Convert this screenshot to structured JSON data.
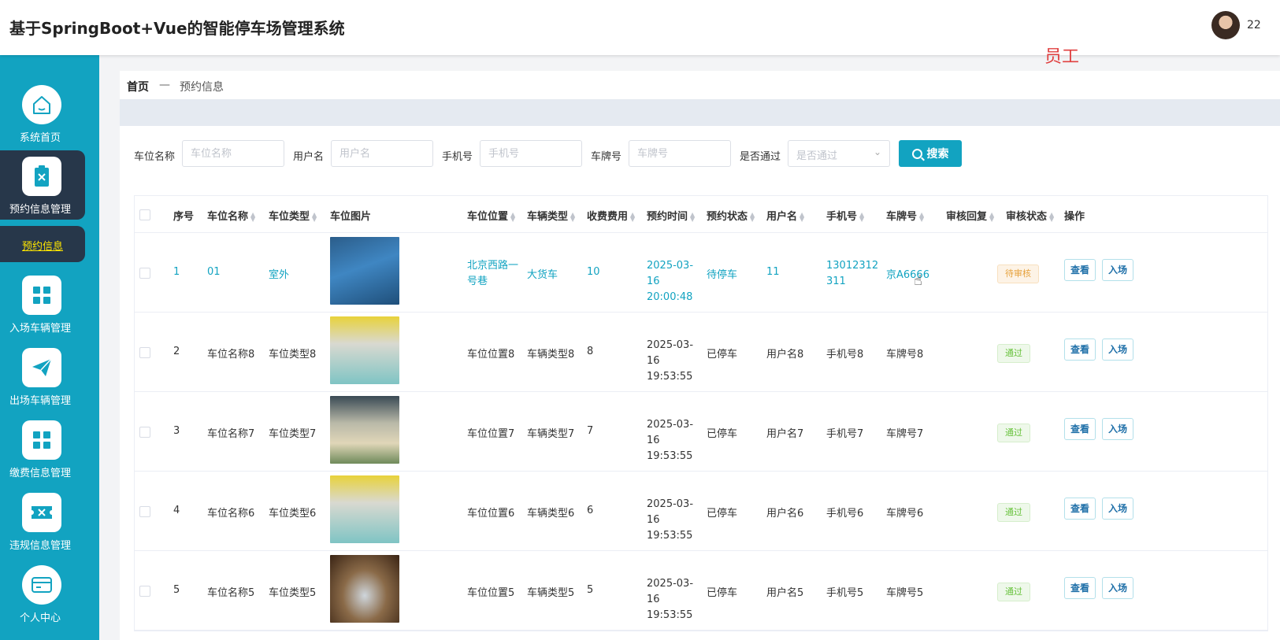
{
  "app": {
    "title": "基于SpringBoot+Vue的智能停车场管理系统",
    "username": "22",
    "role_label": "员工"
  },
  "sidebar": {
    "items": [
      {
        "label": "系统首页",
        "icon": "home-icon"
      },
      {
        "label": "预约信息管理",
        "icon": "clipboard-x-icon"
      },
      {
        "label": "入场车辆管理",
        "icon": "grid-icon"
      },
      {
        "label": "出场车辆管理",
        "icon": "paper-plane-icon"
      },
      {
        "label": "缴费信息管理",
        "icon": "grid-icon"
      },
      {
        "label": "违规信息管理",
        "icon": "ticket-icon"
      },
      {
        "label": "个人中心",
        "icon": "wallet-icon"
      }
    ],
    "sub_active": "预约信息",
    "active_color": "#27374a",
    "sub_active_color": "#ffe600"
  },
  "breadcrumb": {
    "home": "首页",
    "sep": "—",
    "current": "预约信息"
  },
  "filters": {
    "parking_name": {
      "label": "车位名称",
      "placeholder": "车位名称"
    },
    "user_name": {
      "label": "用户名",
      "placeholder": "用户名"
    },
    "phone": {
      "label": "手机号",
      "placeholder": "手机号"
    },
    "plate": {
      "label": "车牌号",
      "placeholder": "车牌号"
    },
    "passed": {
      "label": "是否通过",
      "placeholder": "是否通过"
    },
    "search_label": "搜索"
  },
  "table": {
    "columns": [
      "序号",
      "车位名称",
      "车位类型",
      "车位图片",
      "车位位置",
      "车辆类型",
      "收费费用",
      "预约时间",
      "预约状态",
      "用户名",
      "手机号",
      "车牌号",
      "审核回复",
      "审核状态",
      "操作"
    ],
    "view_label": "查看",
    "enter_label": "入场",
    "rows": [
      {
        "no": "1",
        "name": "01",
        "type": "室外",
        "location": "北京西路一号巷",
        "vehicle": "大货车",
        "fee": "10",
        "time": "2025-03-16 20:00:48",
        "status": "待停车",
        "user": "11",
        "phone": "13012312311",
        "plate": "京A6666",
        "reply": "",
        "audit": "待审核"
      },
      {
        "no": "2",
        "name": "车位名称8",
        "type": "车位类型8",
        "location": "车位位置8",
        "vehicle": "车辆类型8",
        "fee": "8",
        "time": "2025-03-16 19:53:55",
        "status": "已停车",
        "user": "用户名8",
        "phone": "手机号8",
        "plate": "车牌号8",
        "reply": "",
        "audit": "通过"
      },
      {
        "no": "3",
        "name": "车位名称7",
        "type": "车位类型7",
        "location": "车位位置7",
        "vehicle": "车辆类型7",
        "fee": "7",
        "time": "2025-03-16 19:53:55",
        "status": "已停车",
        "user": "用户名7",
        "phone": "手机号7",
        "plate": "车牌号7",
        "reply": "",
        "audit": "通过"
      },
      {
        "no": "4",
        "name": "车位名称6",
        "type": "车位类型6",
        "location": "车位位置6",
        "vehicle": "车辆类型6",
        "fee": "6",
        "time": "2025-03-16 19:53:55",
        "status": "已停车",
        "user": "用户名6",
        "phone": "手机号6",
        "plate": "车牌号6",
        "reply": "",
        "audit": "通过"
      },
      {
        "no": "5",
        "name": "车位名称5",
        "type": "车位类型5",
        "location": "车位位置5",
        "vehicle": "车辆类型5",
        "fee": "5",
        "time": "2025-03-16 19:53:55",
        "status": "已停车",
        "user": "用户名5",
        "phone": "手机号5",
        "plate": "车牌号5",
        "reply": "",
        "audit": "通过"
      }
    ]
  },
  "colors": {
    "accent": "#12a3c1",
    "sidebar_bg": "#12a3c1",
    "role": "#e04040",
    "pending": "#e6a23c",
    "pass": "#67c23a"
  }
}
